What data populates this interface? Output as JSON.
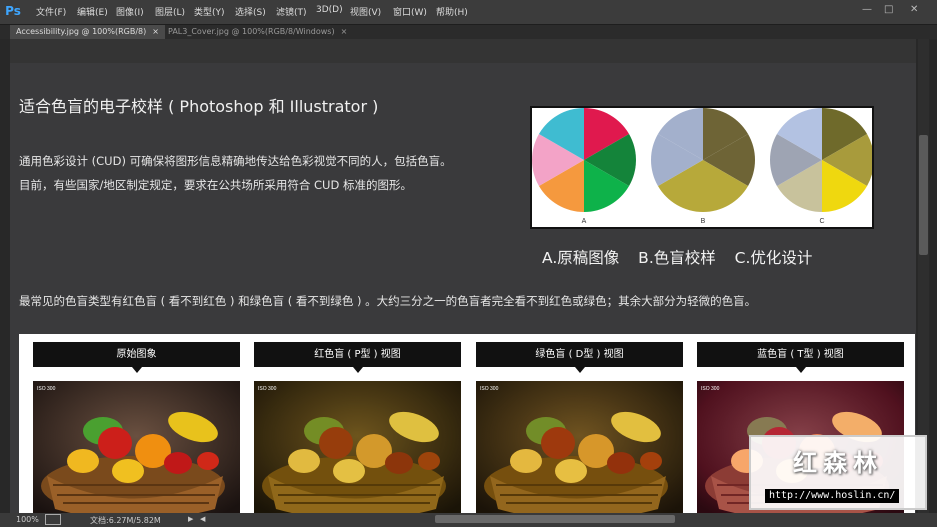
{
  "app": {
    "logo": "Ps"
  },
  "menu": [
    "文件(F)",
    "编辑(E)",
    "图像(I)",
    "图层(L)",
    "类型(Y)",
    "选择(S)",
    "滤镜(T)",
    "3D(D)",
    "视图(V)",
    "窗口(W)",
    "帮助(H)"
  ],
  "window_controls": {
    "minimize": "—",
    "restore": "□",
    "close": "✕"
  },
  "tabs": [
    {
      "label": "Accessibility.jpg @ 100%(RGB/8)",
      "close": "×"
    },
    {
      "label": "PAL3_Cover.jpg @ 100%(RGB/8/Windows)",
      "close": "×"
    }
  ],
  "document": {
    "heading": "适合色盲的电子校样 ( Photoshop 和 Illustrator )",
    "para1_line1": "通用色彩设计 (CUD) 可确保将图形信息精确地传达给色彩视觉不同的人，包括色盲。",
    "para1_line2": "目前，有些国家/地区制定规定，要求在公共场所采用符合 CUD 标准的图形。",
    "pie_caption": "A.原稿图像 B.色盲校样 C.优化设计",
    "para2": "最常见的色盲类型有红色盲 ( 看不到红色 ) 和绿色盲 ( 看不到绿色 ) 。大约三分之一的色盲者完全看不到红色或绿色；其余大部分为轻微的色盲。",
    "pies": [
      {
        "label": "A",
        "colors": [
          "#e0194e",
          "#14843a",
          "#0eb24a",
          "#f5993e",
          "#f3a3c7",
          "#3fbcd1"
        ]
      },
      {
        "label": "B",
        "colors": [
          "#6e6436",
          "#6e6436",
          "#b7a93a",
          "#b7a93a",
          "#a3b0cc",
          "#a3b0cc"
        ]
      },
      {
        "label": "C",
        "colors": [
          "#6f6a2b",
          "#a89b3c",
          "#efd80f",
          "#c8c29c",
          "#9ea4b3",
          "#b3c2e2"
        ]
      }
    ],
    "panels": [
      {
        "label": "原始图象",
        "iso": "ISO 300",
        "tint": "#000000",
        "tint_opacity": 0
      },
      {
        "label": "红色盲 ( P型 ) 视图",
        "iso": "ISO 300",
        "tint": "#b49a3a",
        "tint_opacity": 0.55
      },
      {
        "label": "绿色盲 ( D型 ) 视图",
        "iso": "ISO 300",
        "tint": "#c0a046",
        "tint_opacity": 0.5
      },
      {
        "label": "蓝色盲 ( T型 ) 视图",
        "iso": "ISO 300",
        "tint": "#e07090",
        "tint_opacity": 0.5
      }
    ]
  },
  "watermark": {
    "title": "红森林",
    "url": "http://www.hoslin.cn/"
  },
  "status": {
    "zoom": "100%",
    "doc_info": "文档:6.27M/5.82M"
  }
}
